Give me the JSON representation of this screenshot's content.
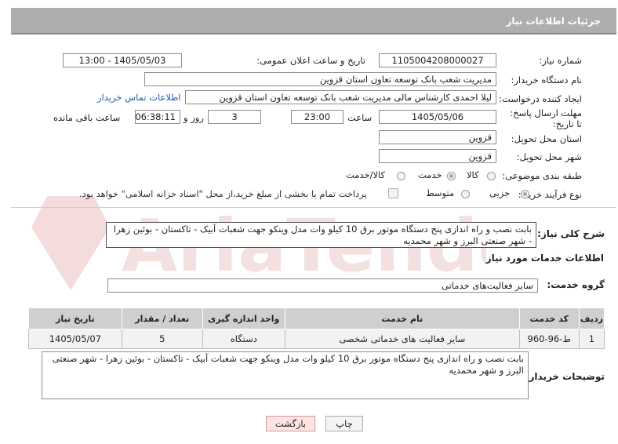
{
  "header": {
    "title": "جزئیات اطلاعات نیاز"
  },
  "form": {
    "need_number_label": "شماره نیاز:",
    "need_number": "1105004208000027",
    "announce_label": "تاریخ و ساعت اعلان عمومی:",
    "announce_value": "1405/05/03 - 13:00",
    "buyer_label": "نام دستگاه خریدار:",
    "buyer_value": "مدیریت شعب بانک توسعه تعاون استان قزوین",
    "requester_label": "ایجاد کننده درخواست:",
    "requester_value": "لیلا احمدی کارشناس مالی مدیریت شعب بانک توسعه تعاون استان قزوین",
    "contact_link": "اطلاعات تماس خریدار",
    "deadline_label": "مهلت ارسال پاسخ: تا تاریخ:",
    "deadline_date": "1405/05/06",
    "time_label": "ساعت",
    "deadline_time": "23:00",
    "days_value": "3",
    "days_label": "روز و",
    "remaining_time": "06:38:11",
    "remaining_label": "ساعت باقی مانده",
    "province_label": "استان محل تحویل:",
    "province_value": "قزوین",
    "city_label": "شهر محل تحویل:",
    "city_value": "قزوین",
    "category_label": "طبقه بندی موضوعی:",
    "category_options": [
      "کالا",
      "خدمت",
      "کالا/خدمت"
    ],
    "category_selected": "خدمت",
    "process_label": "نوع فرآیند خرید :",
    "process_options": [
      "جزیی",
      "متوسط"
    ],
    "process_selected": "جزیی",
    "payment_note": "پرداخت تمام یا بخشی از مبلغ خرید،از محل \"اسناد خزانه اسلامی\" خواهد بود."
  },
  "summary": {
    "label": "شرح کلی نیاز:",
    "value": "بابت نصب و راه اندازی پنج دستگاه موتور برق 10 کیلو وات مدل وینکو جهت شعبات آبیک - تاکستان - بوئین زهرا - شهر صنعتی البرز و شهر محمدیه"
  },
  "services": {
    "section_title": "اطلاعات خدمات مورد نیاز",
    "group_label": "گروه خدمت:",
    "group_value": "سایر فعالیت‌های خدماتی",
    "columns": [
      "ردیف",
      "کد خدمت",
      "نام خدمت",
      "واحد اندازه گیری",
      "تعداد / مقدار",
      "تاریخ نیاز"
    ],
    "rows": [
      [
        "1",
        "ط-96-960",
        "سایر فعالیت های خدماتی شخصی",
        "دستگاه",
        "5",
        "1405/05/07"
      ]
    ]
  },
  "buyer_notes": {
    "label": "توضیحات خریدار:",
    "value": "بابت نصب و راه اندازی پنج دستگاه موتور برق 10 کیلو وات مدل وینکو جهت شعبات آبیک - تاکستان - بوئین زهرا - شهر صنعتی البرز و شهر محمدیه"
  },
  "buttons": {
    "print": "چاپ",
    "back": "بازگشت"
  },
  "watermark": "AriaTender.net",
  "colors": {
    "header_bg": "#aeaeae",
    "link": "#1a5fb4",
    "back_button": "#fde3e3",
    "watermark": "#f3dada"
  }
}
